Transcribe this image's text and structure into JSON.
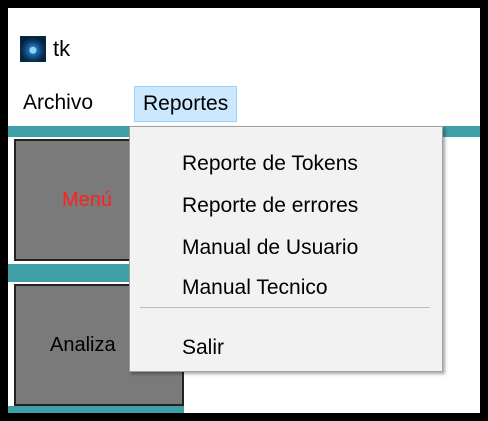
{
  "window": {
    "title": "tk",
    "icon": "tk-app-icon"
  },
  "menubar": {
    "items": [
      {
        "label": "Archivo"
      },
      {
        "label": "Reportes"
      }
    ]
  },
  "dropdown": {
    "items": [
      {
        "label": "Reporte de Tokens"
      },
      {
        "label": "Reporte de errores"
      },
      {
        "label": "Manual de Usuario"
      },
      {
        "label": "Manual Tecnico"
      },
      {
        "label": "Salir"
      }
    ]
  },
  "side_buttons": {
    "menu_label": "Menú",
    "analiza_label": "Analiza"
  },
  "colors": {
    "accent_strip": "#3f9fa6",
    "button_bg": "#7a7a7a",
    "menu_text_red": "#ff2020",
    "menu_highlight": "#cce8ff"
  }
}
